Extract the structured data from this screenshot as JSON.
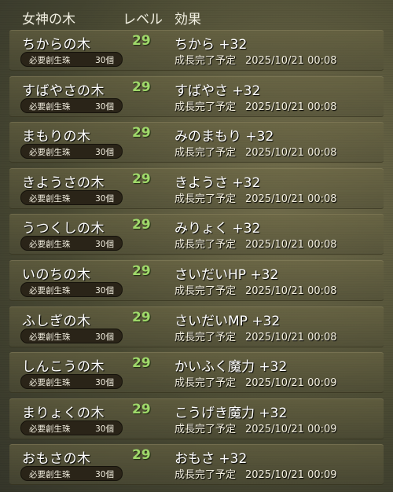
{
  "header": {
    "name_col": "女神の木",
    "level_col": "レベル",
    "effect_col": "効果"
  },
  "orb_label": "必要創生珠",
  "complete_label": "成長完了予定",
  "rows": [
    {
      "name": "ちからの木",
      "level": "29",
      "effect": "ちから +32",
      "orb_count": "30個",
      "datetime": "2025/10/21 00:08"
    },
    {
      "name": "すばやさの木",
      "level": "29",
      "effect": "すばやさ +32",
      "orb_count": "30個",
      "datetime": "2025/10/21 00:08"
    },
    {
      "name": "まもりの木",
      "level": "29",
      "effect": "みのまもり +32",
      "orb_count": "30個",
      "datetime": "2025/10/21 00:08"
    },
    {
      "name": "きようさの木",
      "level": "29",
      "effect": "きようさ +32",
      "orb_count": "30個",
      "datetime": "2025/10/21 00:08"
    },
    {
      "name": "うつくしの木",
      "level": "29",
      "effect": "みりょく +32",
      "orb_count": "30個",
      "datetime": "2025/10/21 00:08"
    },
    {
      "name": "いのちの木",
      "level": "29",
      "effect": "さいだいHP +32",
      "orb_count": "30個",
      "datetime": "2025/10/21 00:08"
    },
    {
      "name": "ふしぎの木",
      "level": "29",
      "effect": "さいだいMP +32",
      "orb_count": "30個",
      "datetime": "2025/10/21 00:08"
    },
    {
      "name": "しんこうの木",
      "level": "29",
      "effect": "かいふく魔力 +32",
      "orb_count": "30個",
      "datetime": "2025/10/21 00:09"
    },
    {
      "name": "まりょくの木",
      "level": "29",
      "effect": "こうげき魔力 +32",
      "orb_count": "30個",
      "datetime": "2025/10/21 00:09"
    },
    {
      "name": "おもさの木",
      "level": "29",
      "effect": "おもさ +32",
      "orb_count": "30個",
      "datetime": "2025/10/21 00:09"
    }
  ]
}
